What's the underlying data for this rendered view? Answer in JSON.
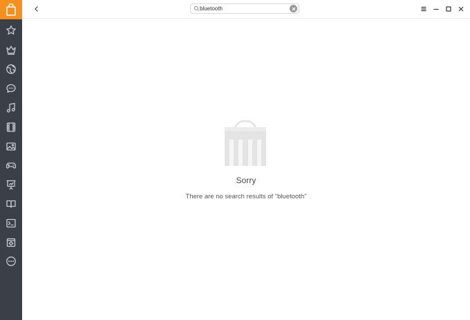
{
  "sidebar": {
    "logo_icon": "store-bag-icon",
    "accent": "#f7901e",
    "items": [
      {
        "icon": "star-icon"
      },
      {
        "icon": "crown-icon"
      },
      {
        "icon": "globe-icon"
      },
      {
        "icon": "chat-icon"
      },
      {
        "icon": "music-icon"
      },
      {
        "icon": "film-icon"
      },
      {
        "icon": "image-icon"
      },
      {
        "icon": "gamepad-icon"
      },
      {
        "icon": "presentation-icon"
      },
      {
        "icon": "book-icon"
      },
      {
        "icon": "terminal-icon"
      },
      {
        "icon": "system-icon"
      },
      {
        "icon": "more-icon"
      }
    ]
  },
  "header": {
    "search_value": "bluetooth"
  },
  "main": {
    "empty_title": "Sorry",
    "empty_message": "There are no search results of \"bluetooth\""
  }
}
